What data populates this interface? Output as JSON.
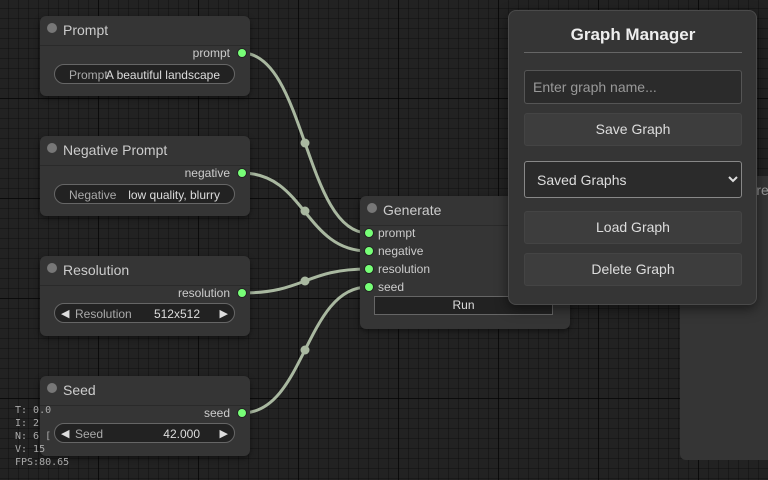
{
  "nodes": {
    "prompt": {
      "title": "Prompt",
      "output": "prompt",
      "widget_label": "Prompt",
      "widget_value": "A beautiful landscape"
    },
    "negative": {
      "title": "Negative Prompt",
      "output": "negative",
      "widget_label": "Negative",
      "widget_value": "low quality, blurry"
    },
    "resolution": {
      "title": "Resolution",
      "output": "resolution",
      "widget_label": "Resolution",
      "widget_value": "512x512"
    },
    "seed": {
      "title": "Seed",
      "output": "seed",
      "widget_label": "Seed",
      "widget_value": "42.000"
    },
    "generate": {
      "title": "Generate",
      "inputs": [
        "prompt",
        "negative",
        "resolution",
        "seed"
      ],
      "run_label": "Run"
    },
    "preview": {
      "title_fragment": "Pre"
    }
  },
  "stats": {
    "t": "T: 0.0",
    "i": "I: 2",
    "n": "N: 6 [",
    "v": "V: 15",
    "fps": "FPS:80.65"
  },
  "graph_manager": {
    "title": "Graph Manager",
    "name_placeholder": "Enter graph name...",
    "save_label": "Save Graph",
    "saved_select_value": "Saved Graphs",
    "load_label": "Load Graph",
    "delete_label": "Delete Graph"
  },
  "colors": {
    "slot_dot": "#77ff77",
    "wire": "#a9b8a0",
    "background": "#222222",
    "node": "#353535"
  }
}
